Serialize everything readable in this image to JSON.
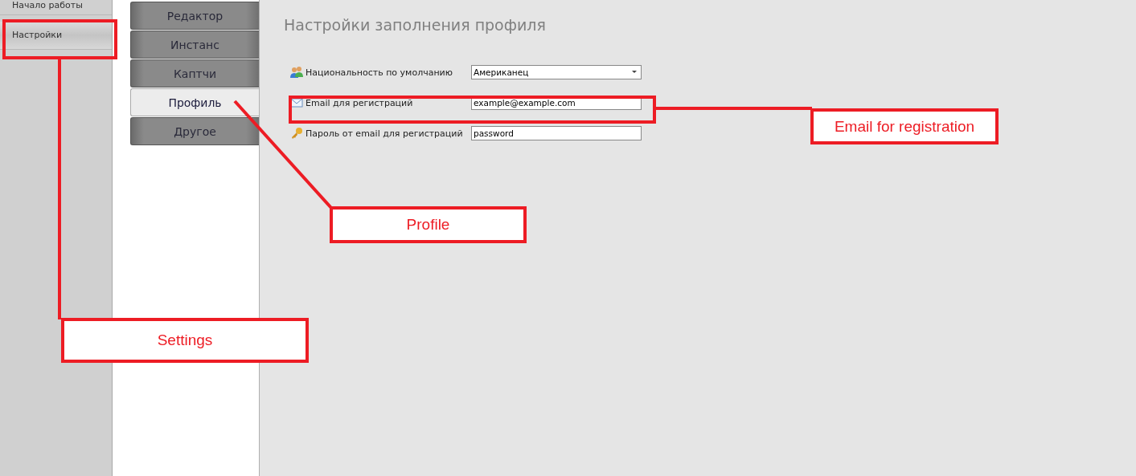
{
  "sidebar": {
    "items": [
      {
        "label": "Начало работы",
        "selected": false
      },
      {
        "label": "Настройки",
        "selected": true
      }
    ]
  },
  "tabs": [
    {
      "label": "Редактор",
      "selected": false
    },
    {
      "label": "Инстанс",
      "selected": false
    },
    {
      "label": "Каптчи",
      "selected": false
    },
    {
      "label": "Профиль",
      "selected": true
    },
    {
      "label": "Другое",
      "selected": false
    }
  ],
  "panel": {
    "title": "Настройки заполнения профиля",
    "fields": [
      {
        "kind": "dropdown",
        "label": "Национальность по умолчанию",
        "value": "Американец"
      },
      {
        "kind": "text",
        "label": "Email для регистраций",
        "value": "example@example.com"
      },
      {
        "kind": "text",
        "label": "Пароль от email для регистраций",
        "value": "password"
      }
    ]
  },
  "annotations": [
    {
      "text": "Settings"
    },
    {
      "text": "Profile"
    },
    {
      "text": "Email for registration"
    }
  ]
}
